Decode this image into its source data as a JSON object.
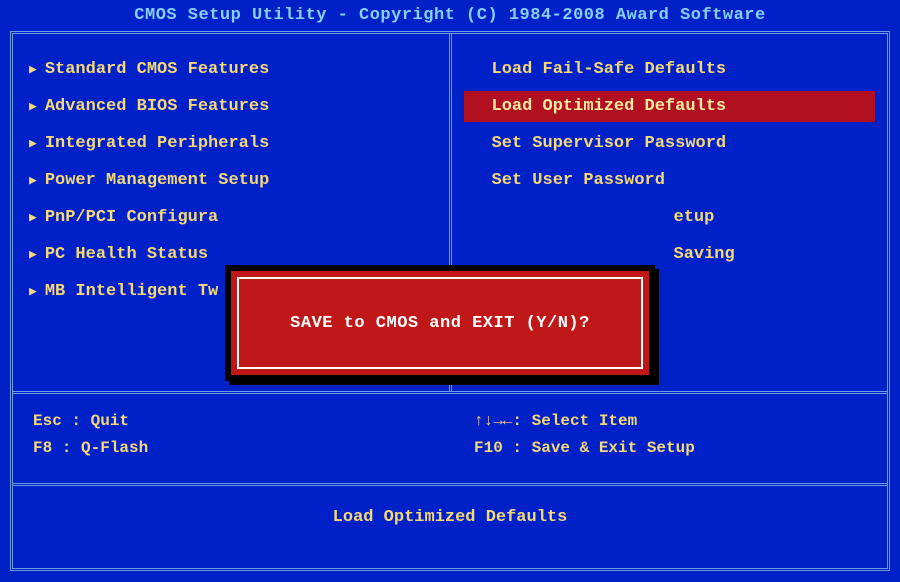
{
  "title": "CMOS Setup Utility - Copyright (C) 1984-2008 Award Software",
  "left_menu": {
    "items": [
      {
        "label": "Standard CMOS Features"
      },
      {
        "label": "Advanced BIOS Features"
      },
      {
        "label": "Integrated Peripherals"
      },
      {
        "label": "Power Management Setup"
      },
      {
        "label": "PnP/PCI Configura"
      },
      {
        "label": "PC Health Status"
      },
      {
        "label": "MB Intelligent Tw"
      }
    ]
  },
  "right_menu": {
    "items": [
      {
        "label": "Load Fail-Safe Defaults",
        "selected": false
      },
      {
        "label": "Load Optimized Defaults",
        "selected": true
      },
      {
        "label": "Set Supervisor Password",
        "selected": false
      },
      {
        "label": "Set User Password",
        "selected": false
      },
      {
        "label": "etup",
        "selected": false
      },
      {
        "label": "Saving",
        "selected": false
      }
    ]
  },
  "hints": {
    "left": {
      "line1": "Esc : Quit",
      "line2": "F8  : Q-Flash"
    },
    "right": {
      "line1": "↑↓→←: Select Item",
      "line2": "F10 : Save & Exit Setup"
    }
  },
  "footer": "Load Optimized Defaults",
  "dialog": {
    "text": "SAVE to CMOS and EXIT (Y/N)?"
  }
}
